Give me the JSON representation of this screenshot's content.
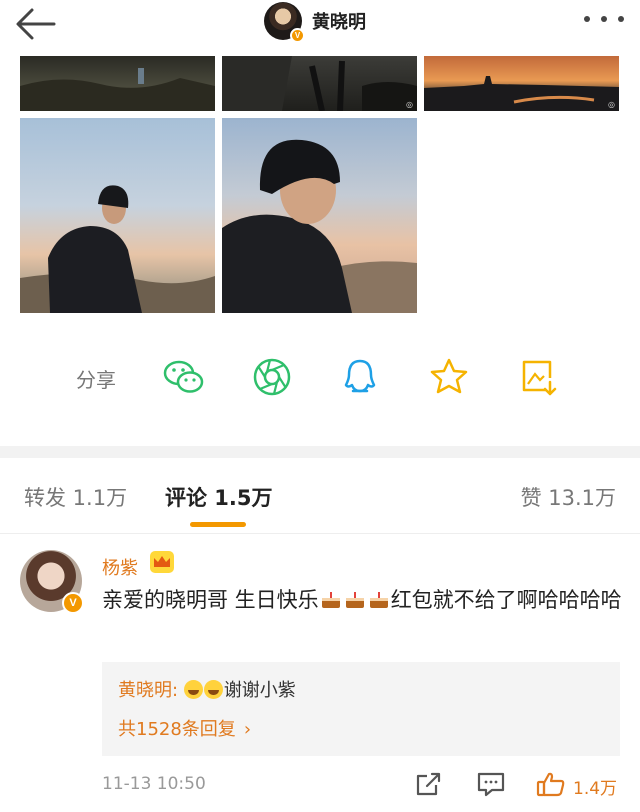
{
  "header": {
    "author_name": "黄晓明",
    "verified_mark": "V"
  },
  "share": {
    "label": "分享"
  },
  "tabs": {
    "forward": "转发 1.1万",
    "comment": "评论 1.5万",
    "like": "赞 13.1万"
  },
  "comment": {
    "author": "杨紫",
    "verified_mark": "V",
    "text_before": "亲爱的晓明哥 生日快乐",
    "text_after": "红包就不给了啊哈哈哈哈",
    "emoji": "cake-icon",
    "reply": {
      "author": "黄晓明:",
      "text": "谢谢小紫",
      "emoji": "laugh-cry-icon"
    },
    "reply_count": "共1528条回复",
    "reply_count_chevron": "›",
    "time": "11-13 10:50",
    "like_count": "1.4万"
  },
  "colors": {
    "accent": "#f39800",
    "name_orange": "#e07a1f",
    "wechat_green": "#2fbf6b",
    "moments_green": "#2fbf6b",
    "qq_blue": "#1ea0e6",
    "favorite_yellow": "#f5b300"
  }
}
